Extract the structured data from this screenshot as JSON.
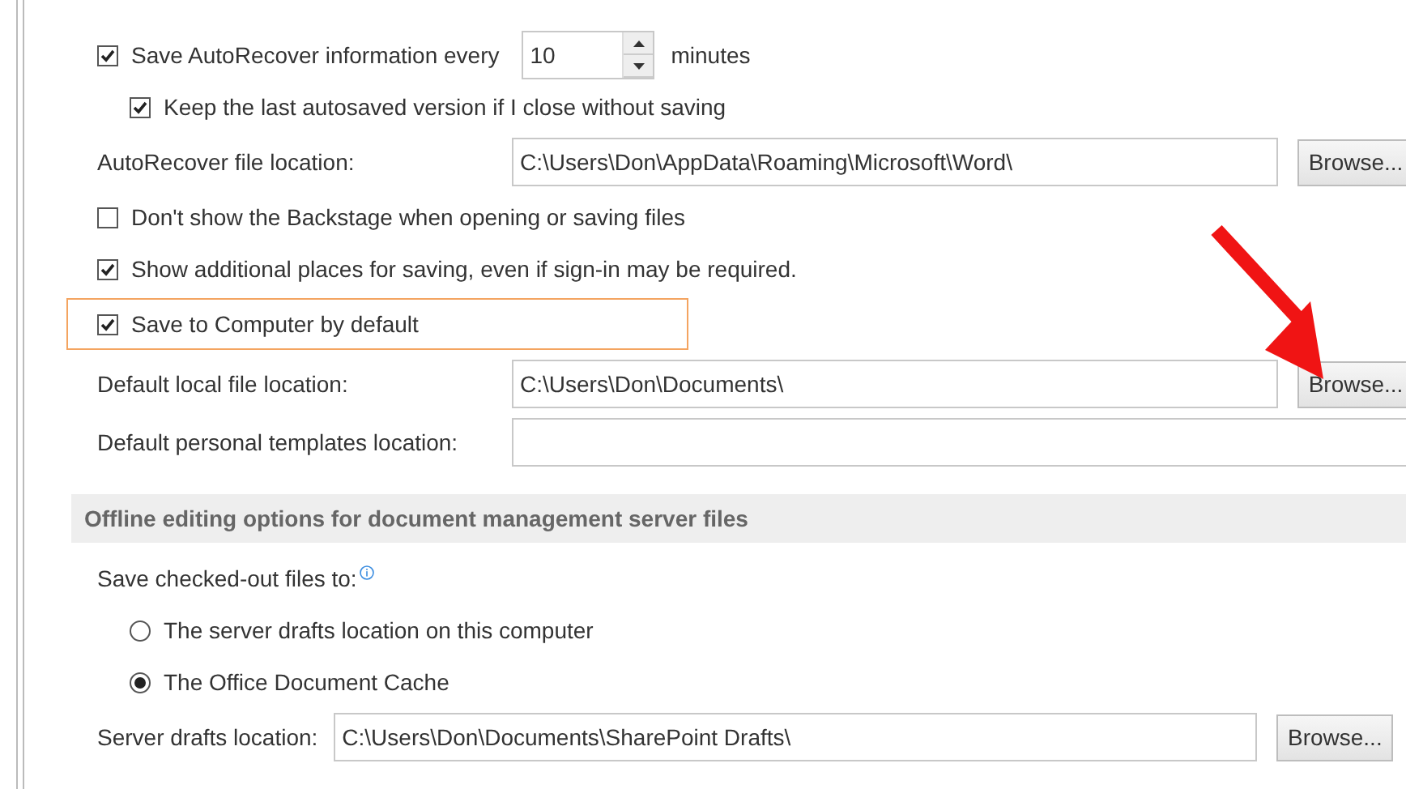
{
  "sections": [
    {
      "rows": [
        {
          "kind": "spin",
          "label": "Save AutoRecover information every",
          "checked": true,
          "value": "10",
          "unit": "minutes",
          "children": [
            {
              "kind": "checkbox",
              "label": "Keep the last autosaved version if I close without saving",
              "checked": true
            }
          ]
        },
        {
          "kind": "path",
          "label": "AutoRecover file location:",
          "value": "C:\\Users\\Don\\AppData\\Roaming\\Microsoft\\Word\\",
          "button": "Browse..."
        },
        {
          "kind": "checkbox",
          "label": "Don't show the Backstage when opening or saving files",
          "checked": false
        },
        {
          "kind": "checkbox",
          "label": "Show additional places for saving, even if sign-in may be required.",
          "checked": true
        },
        {
          "kind": "checkbox",
          "label": "Save to Computer by default",
          "checked": true,
          "highlighted": true
        },
        {
          "kind": "path",
          "label": "Default local file location:",
          "value": "C:\\Users\\Don\\Documents\\",
          "button": "Browse..."
        },
        {
          "kind": "path",
          "label": "Default personal templates location:"
        }
      ]
    },
    {
      "header": "Offline editing options for document management server files",
      "rows": [
        {
          "kind": "radios",
          "label": "Save checked-out files to:",
          "children": [
            {
              "label": "The server drafts location on this computer",
              "selected": false
            },
            {
              "label": "The Office Document Cache",
              "selected": true
            }
          ]
        },
        {
          "kind": "path",
          "label": "Server drafts location:",
          "value": "C:\\Users\\Don\\Documents\\SharePoint Drafts\\",
          "button": "Browse..."
        }
      ]
    }
  ]
}
